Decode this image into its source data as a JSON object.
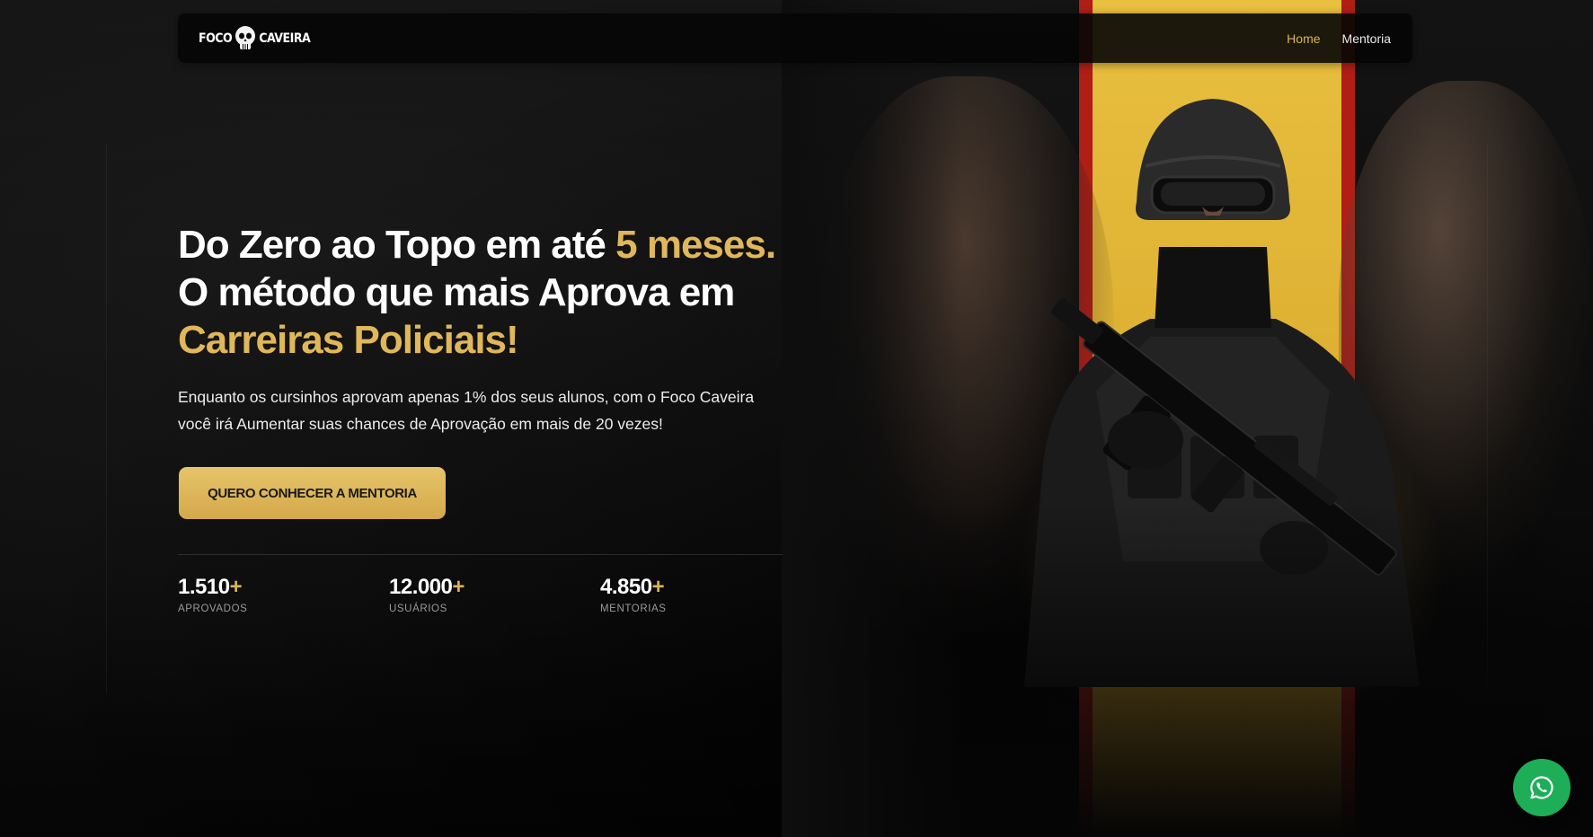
{
  "navbar": {
    "logo": {
      "word_left": "FOCO",
      "word_right": "CAVEIRA",
      "icon": "skull-icon"
    },
    "links": [
      {
        "label": "Home",
        "active": true
      },
      {
        "label": "Mentoria",
        "active": false
      }
    ]
  },
  "hero": {
    "headline": {
      "part1": "Do Zero ao Topo em até ",
      "highlight1": "5 meses.",
      "part2": " O método que mais Aprova em ",
      "highlight2": "Carreiras Policiais!"
    },
    "subtitle": "Enquanto os cursinhos aprovam apenas 1% dos seus alunos, com o Foco Caveira você irá Aumentar suas chances de Aprovação em mais de 20 vezes!",
    "cta_label": "QUERO CONHECER A MENTORIA",
    "stats": [
      {
        "value": "1.510",
        "suffix": "+",
        "label": "APROVADOS"
      },
      {
        "value": "12.000",
        "suffix": "+",
        "label": "USUÁRIOS"
      },
      {
        "value": "4.850",
        "suffix": "+",
        "label": "MENTORIAS"
      }
    ]
  },
  "floating": {
    "icon": "whatsapp-icon"
  },
  "colors": {
    "accent_gold": "#e0b75a",
    "stripe_red": "#b01e16",
    "stripe_gold": "#e9c03f",
    "whatsapp_green": "#1fae58",
    "background": "#0e0e0e"
  }
}
